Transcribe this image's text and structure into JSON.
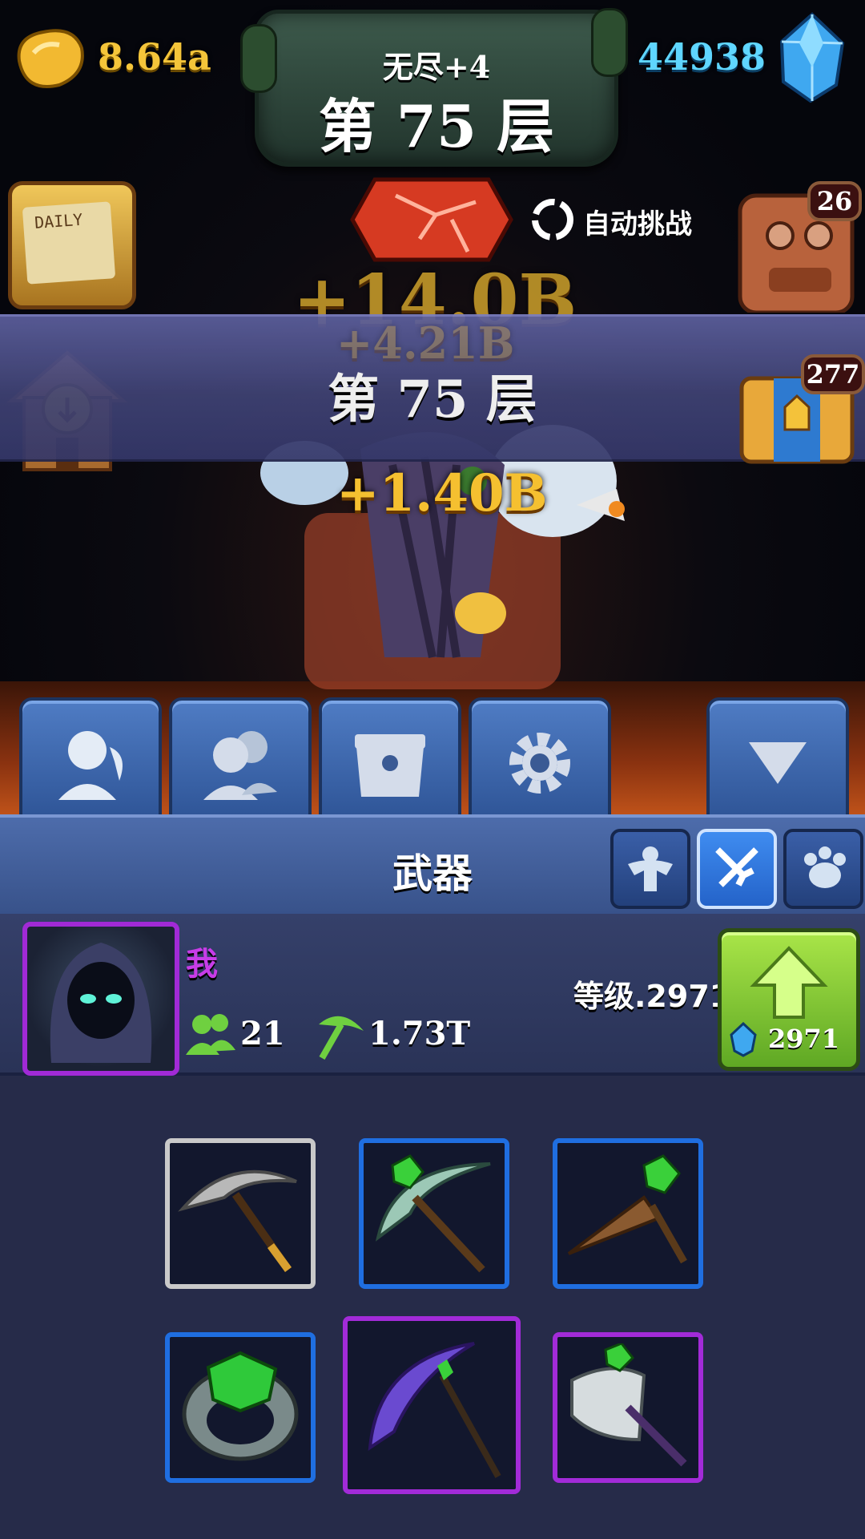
{
  "hud": {
    "gold_amount": "8.64a",
    "gem_amount": "44938",
    "mode_label": "无尽+4",
    "floor_label": "第 75 层"
  },
  "auto_challenge": {
    "label": "自动挑战"
  },
  "side_icons": {
    "daily_calendar_text": "DAILY",
    "robot_badge": "26",
    "chest_badge": "277"
  },
  "battle": {
    "banner_title": "第 75 层",
    "float_numbers": [
      "+14.0B",
      "+4.21B",
      "+1.40B"
    ]
  },
  "tabs": [
    {
      "icon": "hero-icon"
    },
    {
      "icon": "team-icon"
    },
    {
      "icon": "chest-icon"
    },
    {
      "icon": "settings-gear-icon"
    },
    {
      "icon": "collapse-arrow-icon"
    }
  ],
  "weapon_panel": {
    "title": "武器",
    "sub_tabs": [
      {
        "icon": "strength-icon",
        "active": false
      },
      {
        "icon": "weapon-swords-icon",
        "active": true
      },
      {
        "icon": "pet-paw-icon",
        "active": false
      }
    ]
  },
  "player": {
    "name": "我",
    "team_count": "21",
    "mining_power": "1.73T",
    "level_text": "等级.2971",
    "upgrade_cost": "2971"
  },
  "items": [
    {
      "name": "iron-pickaxe-icon",
      "rarity": "white"
    },
    {
      "name": "emerald-pickaxe-icon",
      "rarity": "blue"
    },
    {
      "name": "emerald-drill-icon",
      "rarity": "blue"
    },
    {
      "name": "emerald-ring-icon",
      "rarity": "blue"
    },
    {
      "name": "void-scythe-icon",
      "rarity": "purple"
    },
    {
      "name": "emerald-axe-icon",
      "rarity": "purple"
    }
  ],
  "colors": {
    "gold": "#f5c53a",
    "gem": "#5fd6ff",
    "tab_blue": "#4f7cc4",
    "rarity_white": "#c9c9c9",
    "rarity_blue": "#1f6ee0",
    "rarity_purple": "#a22bd8",
    "upgrade_green": "#a9e548"
  }
}
